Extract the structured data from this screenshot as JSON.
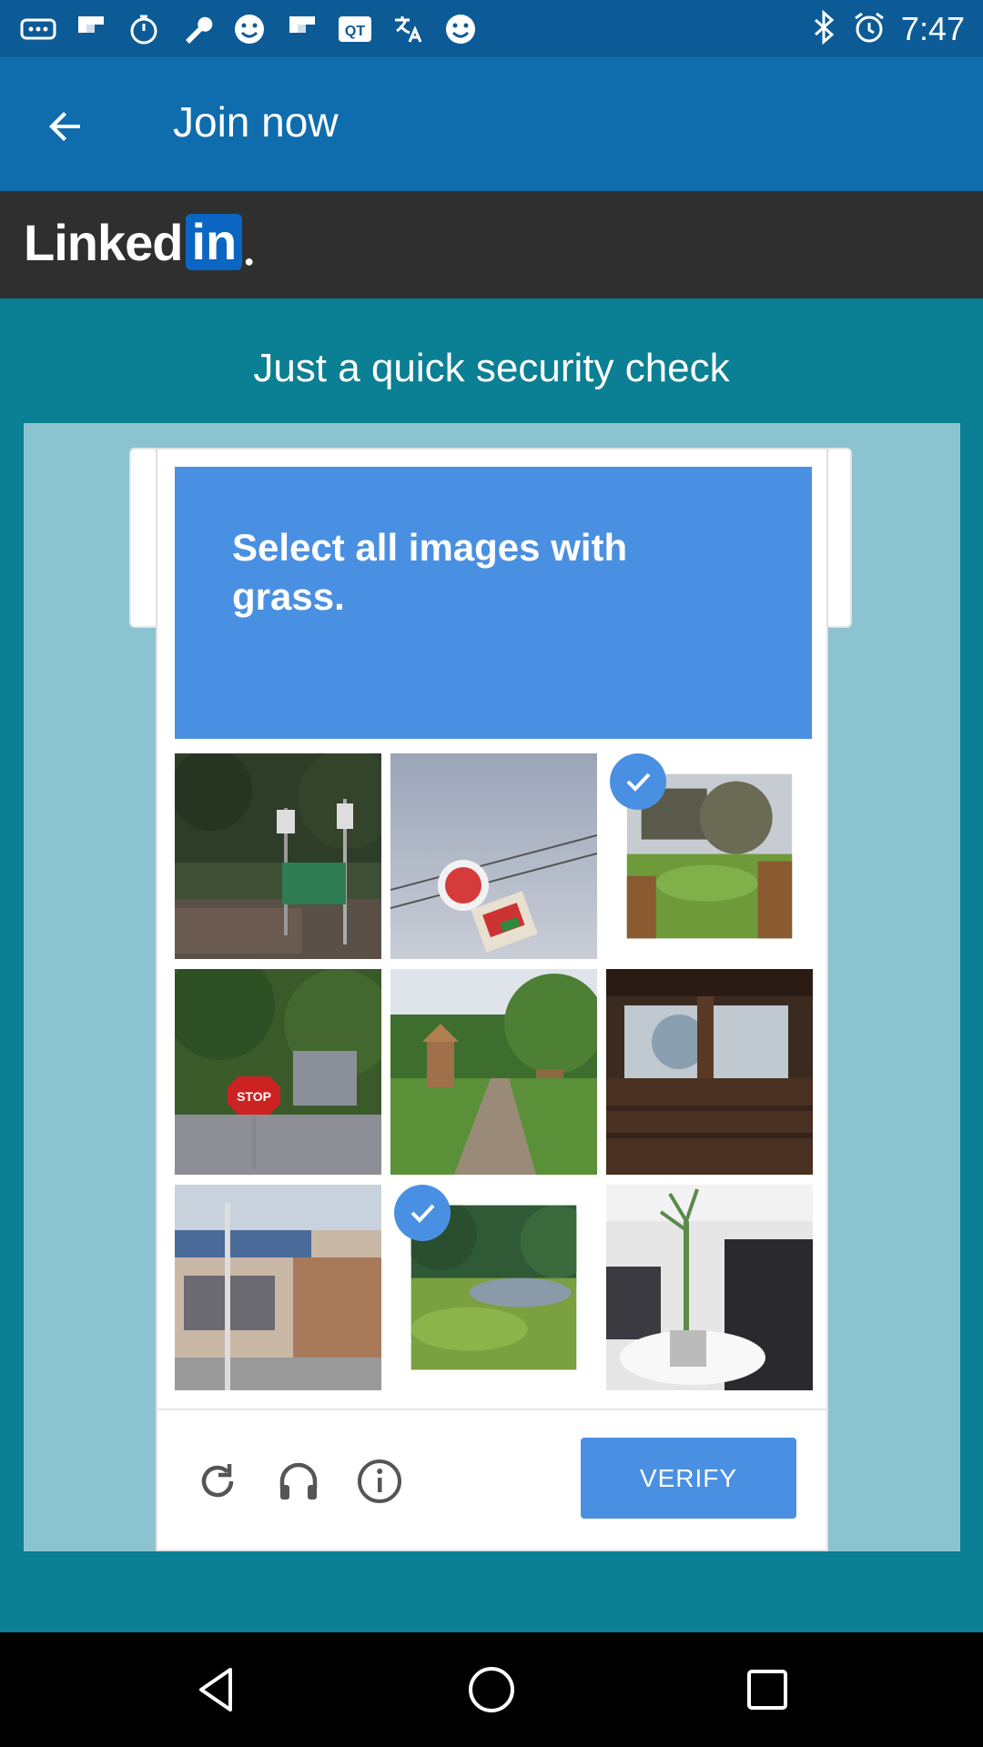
{
  "status_bar": {
    "time": "7:47",
    "left_icons": [
      "more-icon",
      "flipboard-icon",
      "timer-icon",
      "wrench-icon",
      "smiley-icon",
      "flipboard-icon",
      "qt-app-icon",
      "translate-icon",
      "smiley-icon",
      "bluetooth-icon",
      "alarm-icon"
    ]
  },
  "app_bar": {
    "title": "Join now",
    "back_icon": "arrow-back-icon"
  },
  "linkedin": {
    "logo_word": "Linked",
    "logo_box": "in",
    "brand_color": "#0a66c2"
  },
  "page": {
    "heading": "Just a quick security check"
  },
  "captcha": {
    "prompt": "Select all images with grass.",
    "accent": "#4a90e2",
    "tiles": [
      {
        "name": "trees-road-signs",
        "selected": false
      },
      {
        "name": "store-sign",
        "selected": false
      },
      {
        "name": "garden-fence",
        "selected": true
      },
      {
        "name": "stop-sign-trees",
        "selected": false
      },
      {
        "name": "playground-path",
        "selected": false
      },
      {
        "name": "wooden-pavilion",
        "selected": false
      },
      {
        "name": "building-street",
        "selected": false
      },
      {
        "name": "grass-field-trees",
        "selected": true
      },
      {
        "name": "banquet-hall",
        "selected": false
      }
    ],
    "toolbar_icons": [
      "refresh-icon",
      "headphones-icon",
      "info-icon"
    ],
    "verify_label": "VERIFY"
  },
  "nav_bar": {
    "icons": [
      "back-triangle-icon",
      "home-circle-icon",
      "recents-square-icon"
    ]
  }
}
